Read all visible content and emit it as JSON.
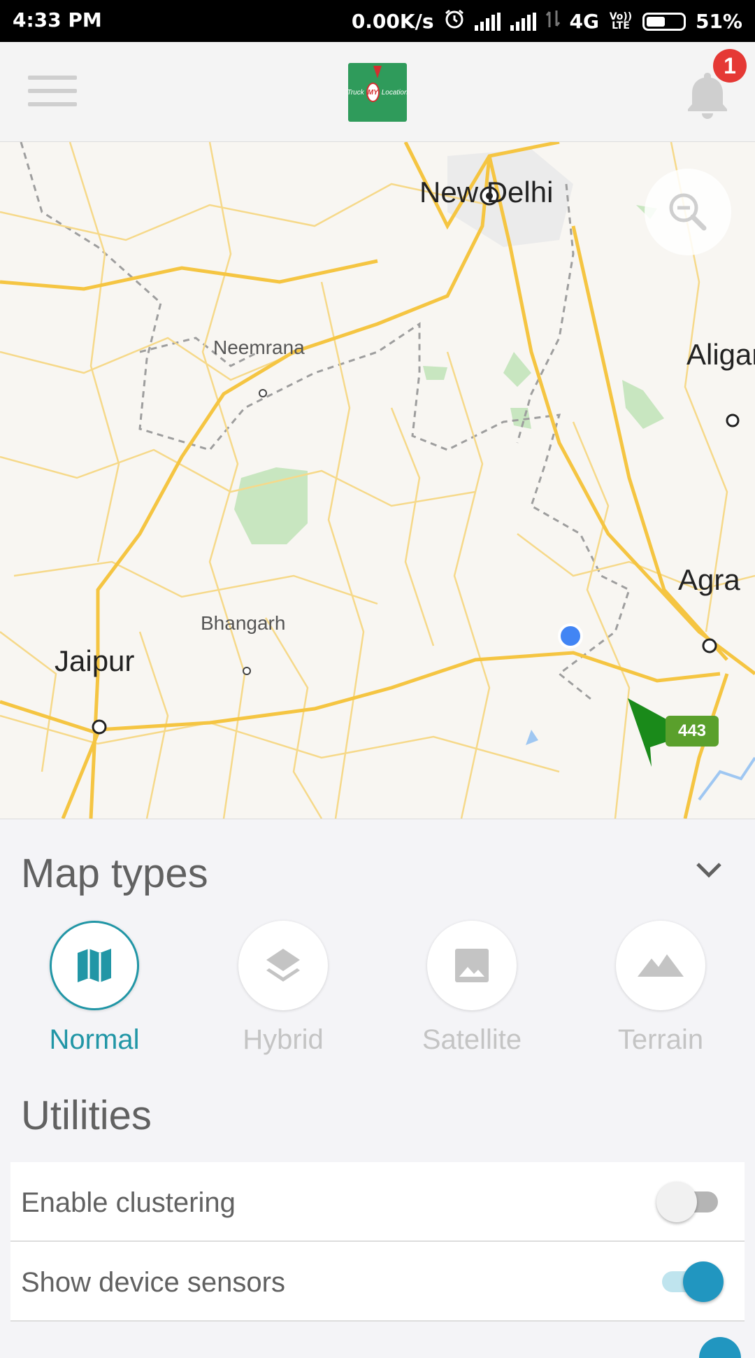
{
  "status_bar": {
    "time": "4:33 PM",
    "network_speed": "0.00K/s",
    "network_type": "4G",
    "volte": "Vo)) LTE",
    "battery": "51%"
  },
  "app_bar": {
    "logo_text_left": "Truck",
    "logo_text_center": "MY",
    "logo_text_right": "Location",
    "notification_count": "1"
  },
  "map": {
    "labels": {
      "new_delhi": "New Delhi",
      "neemrana": "Neemrana",
      "aligarh": "Aligar",
      "agra": "Agra",
      "bhangarh": "Bhangarh",
      "jaipur": "Jaipur"
    },
    "highway_shield": "443"
  },
  "map_types": {
    "title": "Map types",
    "items": [
      {
        "label": "Normal",
        "icon": "map-icon",
        "selected": true
      },
      {
        "label": "Hybrid",
        "icon": "layers-icon",
        "selected": false
      },
      {
        "label": "Satellite",
        "icon": "image-icon",
        "selected": false
      },
      {
        "label": "Terrain",
        "icon": "terrain-icon",
        "selected": false
      }
    ]
  },
  "utilities": {
    "title": "Utilities",
    "rows": [
      {
        "label": "Enable clustering",
        "enabled": false
      },
      {
        "label": "Show device sensors",
        "enabled": true
      }
    ]
  },
  "colors": {
    "accent": "#2196a6",
    "badge": "#e53935",
    "logo_bg": "#2f9b5b",
    "vehicle_marker": "#1a8a1a"
  }
}
